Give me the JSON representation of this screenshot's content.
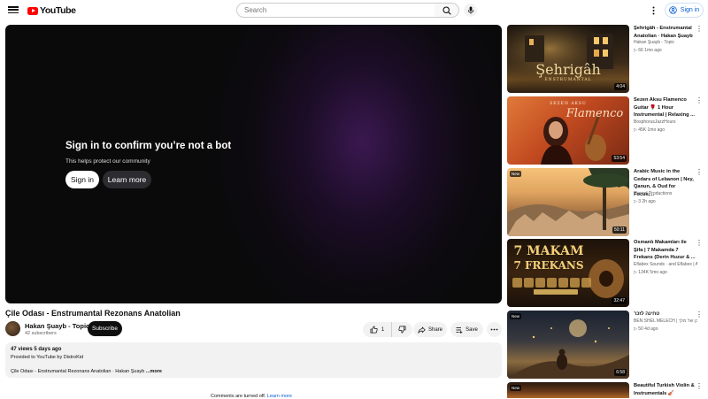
{
  "header": {
    "logo_text": "YouTube",
    "search_placeholder": "Search",
    "signin_label": "Sign in"
  },
  "player": {
    "bot_title": "Sign in to confirm you’re not a bot",
    "bot_subtitle": "This helps protect our community",
    "signin_label": "Sign in",
    "learn_more_label": "Learn more"
  },
  "video": {
    "title": "Çile Odası - Enstrumantal Rezonans Anatolian",
    "channel": "Hakan Şuayb - Topic",
    "subscribers": "42 subscribers",
    "subscribe_label": "Subscribe",
    "likes": "1",
    "share_label": "Share",
    "save_label": "Save"
  },
  "description": {
    "meta": "47 views  5 days ago",
    "line1": "Provided to YouTube by DistroKid",
    "line2": "Çile Odası - Enstrumantal Rezonans Anatolian · Hakan Şuayb",
    "more_label": "...more"
  },
  "comments": {
    "text": "Comments are turned off.",
    "link": "Learn more"
  },
  "sidebar": {
    "items": [
      {
        "title": "Şehrigâh - Enstrumantal Anatolian · Hakan Şuayb",
        "channel": "Hakan Şuayb - Topic",
        "meta": "▷ 66   1mo ago",
        "duration": "4:04",
        "thumb_text": "Şehrigâh",
        "thumb_subtext": "ENSTRUMANTAL",
        "is_new": false
      },
      {
        "title": "Sezen Aksu Flamenco Guitar 🌹 1 Hour Instrumental | Relaxing ...",
        "channel": "BosphorusJazzHours",
        "meta": "▷ 45K   1mo ago",
        "duration": "53:54",
        "thumb_text": "Flamenco",
        "thumb_subtext": "SEZEN AKSU",
        "is_new": false
      },
      {
        "title": "Arabic Music in the Cedars of Lebanon | Ney, Qanun, & Oud for Focus,...",
        "channel": "Plunod Productions",
        "meta": "▷ 3   2h ago",
        "duration": "50:11",
        "is_new": true,
        "new_label": "New"
      },
      {
        "title": "Osmanlı Makamları ile Şifa | 7 Makamda 7 Frekans (Derin Huzur & ...",
        "channel": "Eflabex Sounds · and Eflabex | Ant...",
        "meta": "▷ 134K   5mo ago",
        "duration": "32:47",
        "thumb_text": "7 MAKAM",
        "thumb_subtext": "7 FREKANS",
        "is_new": false
      },
      {
        "title": "טחינה לזכר",
        "channel": "BEN SHEL MELECH | בן של מלך ...",
        "meta": "▷ 50   4d ago",
        "duration": "6:58",
        "is_new": true,
        "new_label": "New"
      },
      {
        "title": "Beautiful Turkish Violin & Instrumentals 🎻",
        "channel": "",
        "meta": "",
        "duration": "",
        "is_new": true,
        "new_label": "New"
      }
    ]
  }
}
